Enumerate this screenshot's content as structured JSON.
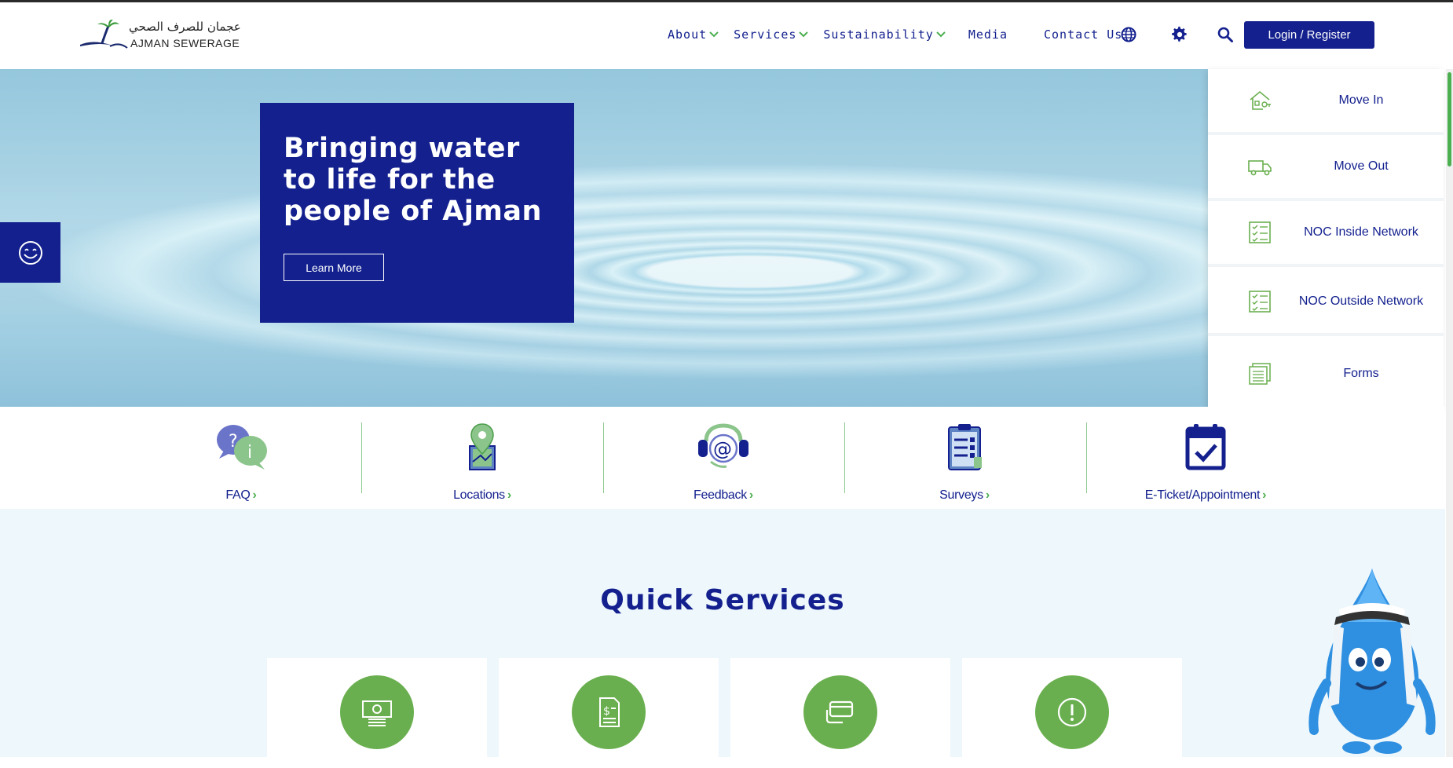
{
  "header": {
    "logo": {
      "arabic": "عجمان للصرف الصحي",
      "english": "AJMAN SEWERAGE"
    },
    "nav": [
      {
        "label": "About",
        "dropdown": true
      },
      {
        "label": "Services",
        "dropdown": true
      },
      {
        "label": "Sustainability",
        "dropdown": true
      },
      {
        "label": "Media",
        "dropdown": false
      },
      {
        "label": "Contact Us",
        "dropdown": false
      }
    ],
    "icons": [
      "globe-icon",
      "gear-icon",
      "search-icon"
    ],
    "login_label": "Login / Register"
  },
  "hero": {
    "title": "Bringing water to life for the people of Ajman",
    "button": "Learn More"
  },
  "side_panel": [
    {
      "label": "Move In",
      "icon": "house-key-icon"
    },
    {
      "label": "Move Out",
      "icon": "truck-icon"
    },
    {
      "label": "NOC Inside Network",
      "icon": "checklist-icon"
    },
    {
      "label": "NOC Outside Network",
      "icon": "checklist-icon"
    },
    {
      "label": "Forms",
      "icon": "documents-icon"
    }
  ],
  "quick_links": [
    {
      "label": "FAQ",
      "icon": "faq-bubbles-icon"
    },
    {
      "label": "Locations",
      "icon": "map-pin-icon"
    },
    {
      "label": "Feedback",
      "icon": "headset-at-icon"
    },
    {
      "label": "Surveys",
      "icon": "clipboard-icon"
    },
    {
      "label": "E-Ticket/Appointment",
      "icon": "calendar-check-icon"
    }
  ],
  "quick_services": {
    "title": "Quick Services",
    "cards": [
      {
        "icon": "money-icon"
      },
      {
        "icon": "invoice-icon"
      },
      {
        "icon": "card-payment-icon"
      },
      {
        "icon": "alert-icon"
      }
    ]
  },
  "colors": {
    "brand_blue": "#13208e",
    "brand_green": "#6aaf4f",
    "accent_green": "#4caf50",
    "section_bg": "#edf7fc"
  }
}
